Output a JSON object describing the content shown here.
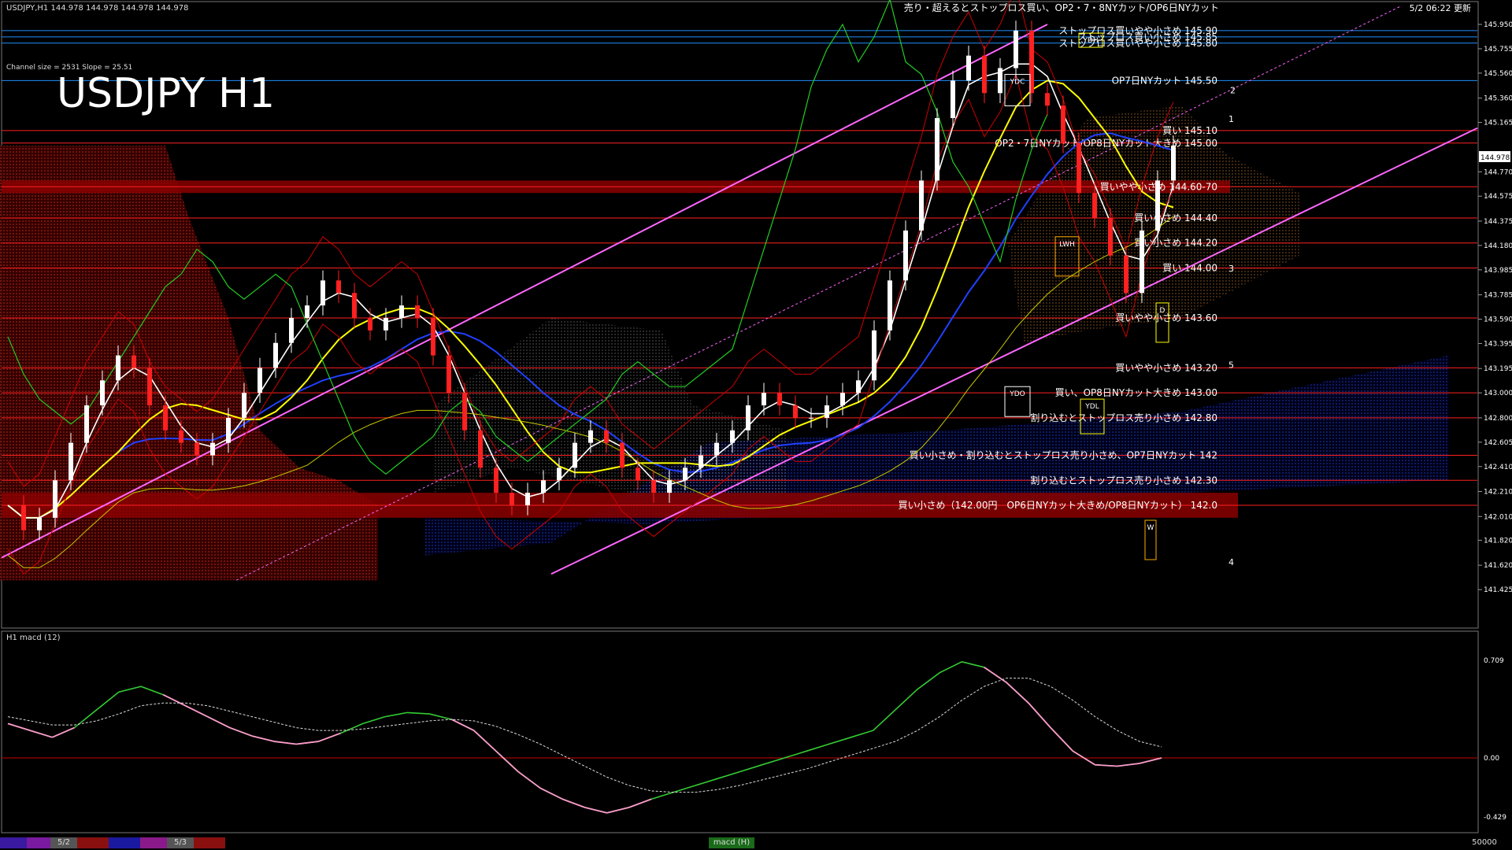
{
  "header": {
    "symbol_info": "USDJPY,H1  144.978 144.978 144.978 144.978",
    "main_comment": "売り・超えるとストップロス買い、OP2・7・8NYカット/OP6日NYカット",
    "timestamp": "5/2 06:22 更新",
    "channel_info": "Channel size = 2531 Slope = 25.51",
    "big_title": "USDJPY H1",
    "current_price": "144.978"
  },
  "price_axis": {
    "ticks": [
      "145.950",
      "145.755",
      "145.560",
      "145.360",
      "145.165",
      "144.770",
      "144.575",
      "144.375",
      "144.180",
      "143.985",
      "143.785",
      "143.590",
      "143.395",
      "143.195",
      "143.000",
      "142.800",
      "142.605",
      "142.410",
      "142.210",
      "142.010",
      "141.820",
      "141.620",
      "141.425"
    ],
    "tick_values": [
      145.95,
      145.755,
      145.56,
      145.36,
      145.165,
      144.77,
      144.575,
      144.375,
      144.18,
      143.985,
      143.785,
      143.59,
      143.395,
      143.195,
      143.0,
      142.8,
      142.605,
      142.41,
      142.21,
      142.01,
      141.82,
      141.62,
      141.425
    ]
  },
  "levels": [
    {
      "price": 145.9,
      "label": "ストップロス買いやや小さめ 145.90",
      "color": "#1e90ff"
    },
    {
      "price": 145.85,
      "label": "ストップロス買い小さめ 145.85",
      "color": "#1e90ff"
    },
    {
      "price": 145.8,
      "label": "ストップロス買いやや小さめ 145.80",
      "color": "#1e90ff"
    },
    {
      "price": 145.5,
      "label": "OP7日NYカット 145.50",
      "color": "#1e90ff"
    },
    {
      "price": 145.1,
      "label": "買い 145.10",
      "color": "#ff2020"
    },
    {
      "price": 145.0,
      "label": "OP2・7日NYカット/OP8日NYカット大きめ 145.00",
      "color": "#ff2020"
    },
    {
      "price": 144.65,
      "label": "買いやや小さめ 144.60-70",
      "color": "#ff2020"
    },
    {
      "price": 144.4,
      "label": "買い小さめ 144.40",
      "color": "#ff2020"
    },
    {
      "price": 144.2,
      "label": "買い小さめ 144.20",
      "color": "#ff2020"
    },
    {
      "price": 144.0,
      "label": "買い 144.00",
      "color": "#ff2020"
    },
    {
      "price": 143.6,
      "label": "買いやや小さめ 143.60",
      "color": "#ff2020"
    },
    {
      "price": 143.2,
      "label": "買いやや小さめ 143.20",
      "color": "#ff2020"
    },
    {
      "price": 143.0,
      "label": "買い、OP8日NYカット大きめ 143.00",
      "color": "#ff2020"
    },
    {
      "price": 142.8,
      "label": "割り込むとストップロス売り小さめ 142.80",
      "color": "#ff2020"
    },
    {
      "price": 142.5,
      "label": "買い小さめ・割り込むとストップロス売り小さめ、OP7日NYカット 142",
      "color": "#ff2020"
    },
    {
      "price": 142.3,
      "label": "割り込むとストップロス売り小さめ 142.30",
      "color": "#ff2020"
    },
    {
      "price": 142.1,
      "label": "買い小さめ（142.00円　OP6日NYカット大きめ/OP8日NYカット） 142.0",
      "color": "#ff2020"
    }
  ],
  "boxes": [
    "YDC",
    "YDH",
    "LWH",
    "YDO",
    "YDL",
    "D",
    "W"
  ],
  "wave_labels": [
    "1",
    "2",
    "3",
    "4",
    "5"
  ],
  "macd": {
    "title": "H1  macd (12)",
    "ticks": [
      "0.709",
      "0.00",
      "-0.429"
    ],
    "tick_values": [
      0.709,
      0.0,
      -0.429
    ]
  },
  "tabs": [
    {
      "label": "",
      "color": "#3a1aa0"
    },
    {
      "label": "",
      "color": "#7a1aa0"
    },
    {
      "label": "5/2",
      "color": "#555555"
    },
    {
      "label": "",
      "color": "#8a1010"
    },
    {
      "label": "",
      "color": "#1a1aa0"
    },
    {
      "label": "",
      "color": "#8a1a8a"
    },
    {
      "label": "5/3",
      "color": "#555555"
    },
    {
      "label": "",
      "color": "#8a1010"
    },
    {
      "label": "macd (H)",
      "color": "#1a6a1a"
    },
    {
      "label": "50000",
      "color": "#000000"
    }
  ],
  "chart_data": {
    "type": "line",
    "title": "USDJPY H1",
    "xlabel": "",
    "ylabel": "",
    "ylim": [
      141.425,
      146.05
    ],
    "price_series_approx": [
      142.1,
      141.9,
      142.0,
      142.3,
      142.6,
      142.9,
      143.1,
      143.3,
      143.2,
      142.9,
      142.7,
      142.6,
      142.5,
      142.6,
      142.8,
      143.0,
      143.2,
      143.4,
      143.6,
      143.7,
      143.9,
      143.8,
      143.6,
      143.5,
      143.6,
      143.7,
      143.6,
      143.3,
      143.0,
      142.7,
      142.4,
      142.2,
      142.1,
      142.2,
      142.3,
      142.4,
      142.6,
      142.7,
      142.6,
      142.4,
      142.3,
      142.2,
      142.3,
      142.4,
      142.5,
      142.6,
      142.7,
      142.9,
      143.0,
      142.9,
      142.8,
      142.8,
      142.9,
      143.0,
      143.1,
      143.5,
      143.9,
      144.3,
      144.7,
      145.2,
      145.5,
      145.7,
      145.4,
      145.6,
      145.9,
      145.4,
      145.3,
      145.0,
      144.6,
      144.4,
      144.1,
      143.8,
      144.3,
      144.7,
      144.98
    ],
    "macd_series_approx": [
      0.25,
      0.2,
      0.15,
      0.22,
      0.35,
      0.48,
      0.52,
      0.46,
      0.38,
      0.3,
      0.22,
      0.16,
      0.12,
      0.1,
      0.12,
      0.18,
      0.25,
      0.3,
      0.33,
      0.32,
      0.28,
      0.2,
      0.05,
      -0.1,
      -0.22,
      -0.3,
      -0.36,
      -0.4,
      -0.36,
      -0.3,
      -0.25,
      -0.2,
      -0.15,
      -0.1,
      -0.05,
      0.0,
      0.05,
      0.1,
      0.15,
      0.2,
      0.35,
      0.5,
      0.62,
      0.7,
      0.66,
      0.55,
      0.4,
      0.22,
      0.05,
      -0.05,
      -0.06,
      -0.04,
      0.0
    ],
    "signal_series_approx": [
      0.3,
      0.27,
      0.24,
      0.24,
      0.27,
      0.32,
      0.38,
      0.4,
      0.4,
      0.38,
      0.34,
      0.3,
      0.26,
      0.22,
      0.2,
      0.2,
      0.21,
      0.23,
      0.25,
      0.27,
      0.28,
      0.27,
      0.23,
      0.17,
      0.1,
      0.02,
      -0.06,
      -0.14,
      -0.2,
      -0.24,
      -0.25,
      -0.25,
      -0.23,
      -0.2,
      -0.16,
      -0.12,
      -0.08,
      -0.03,
      0.02,
      0.07,
      0.12,
      0.2,
      0.3,
      0.42,
      0.52,
      0.58,
      0.58,
      0.52,
      0.42,
      0.3,
      0.2,
      0.12,
      0.08
    ]
  }
}
